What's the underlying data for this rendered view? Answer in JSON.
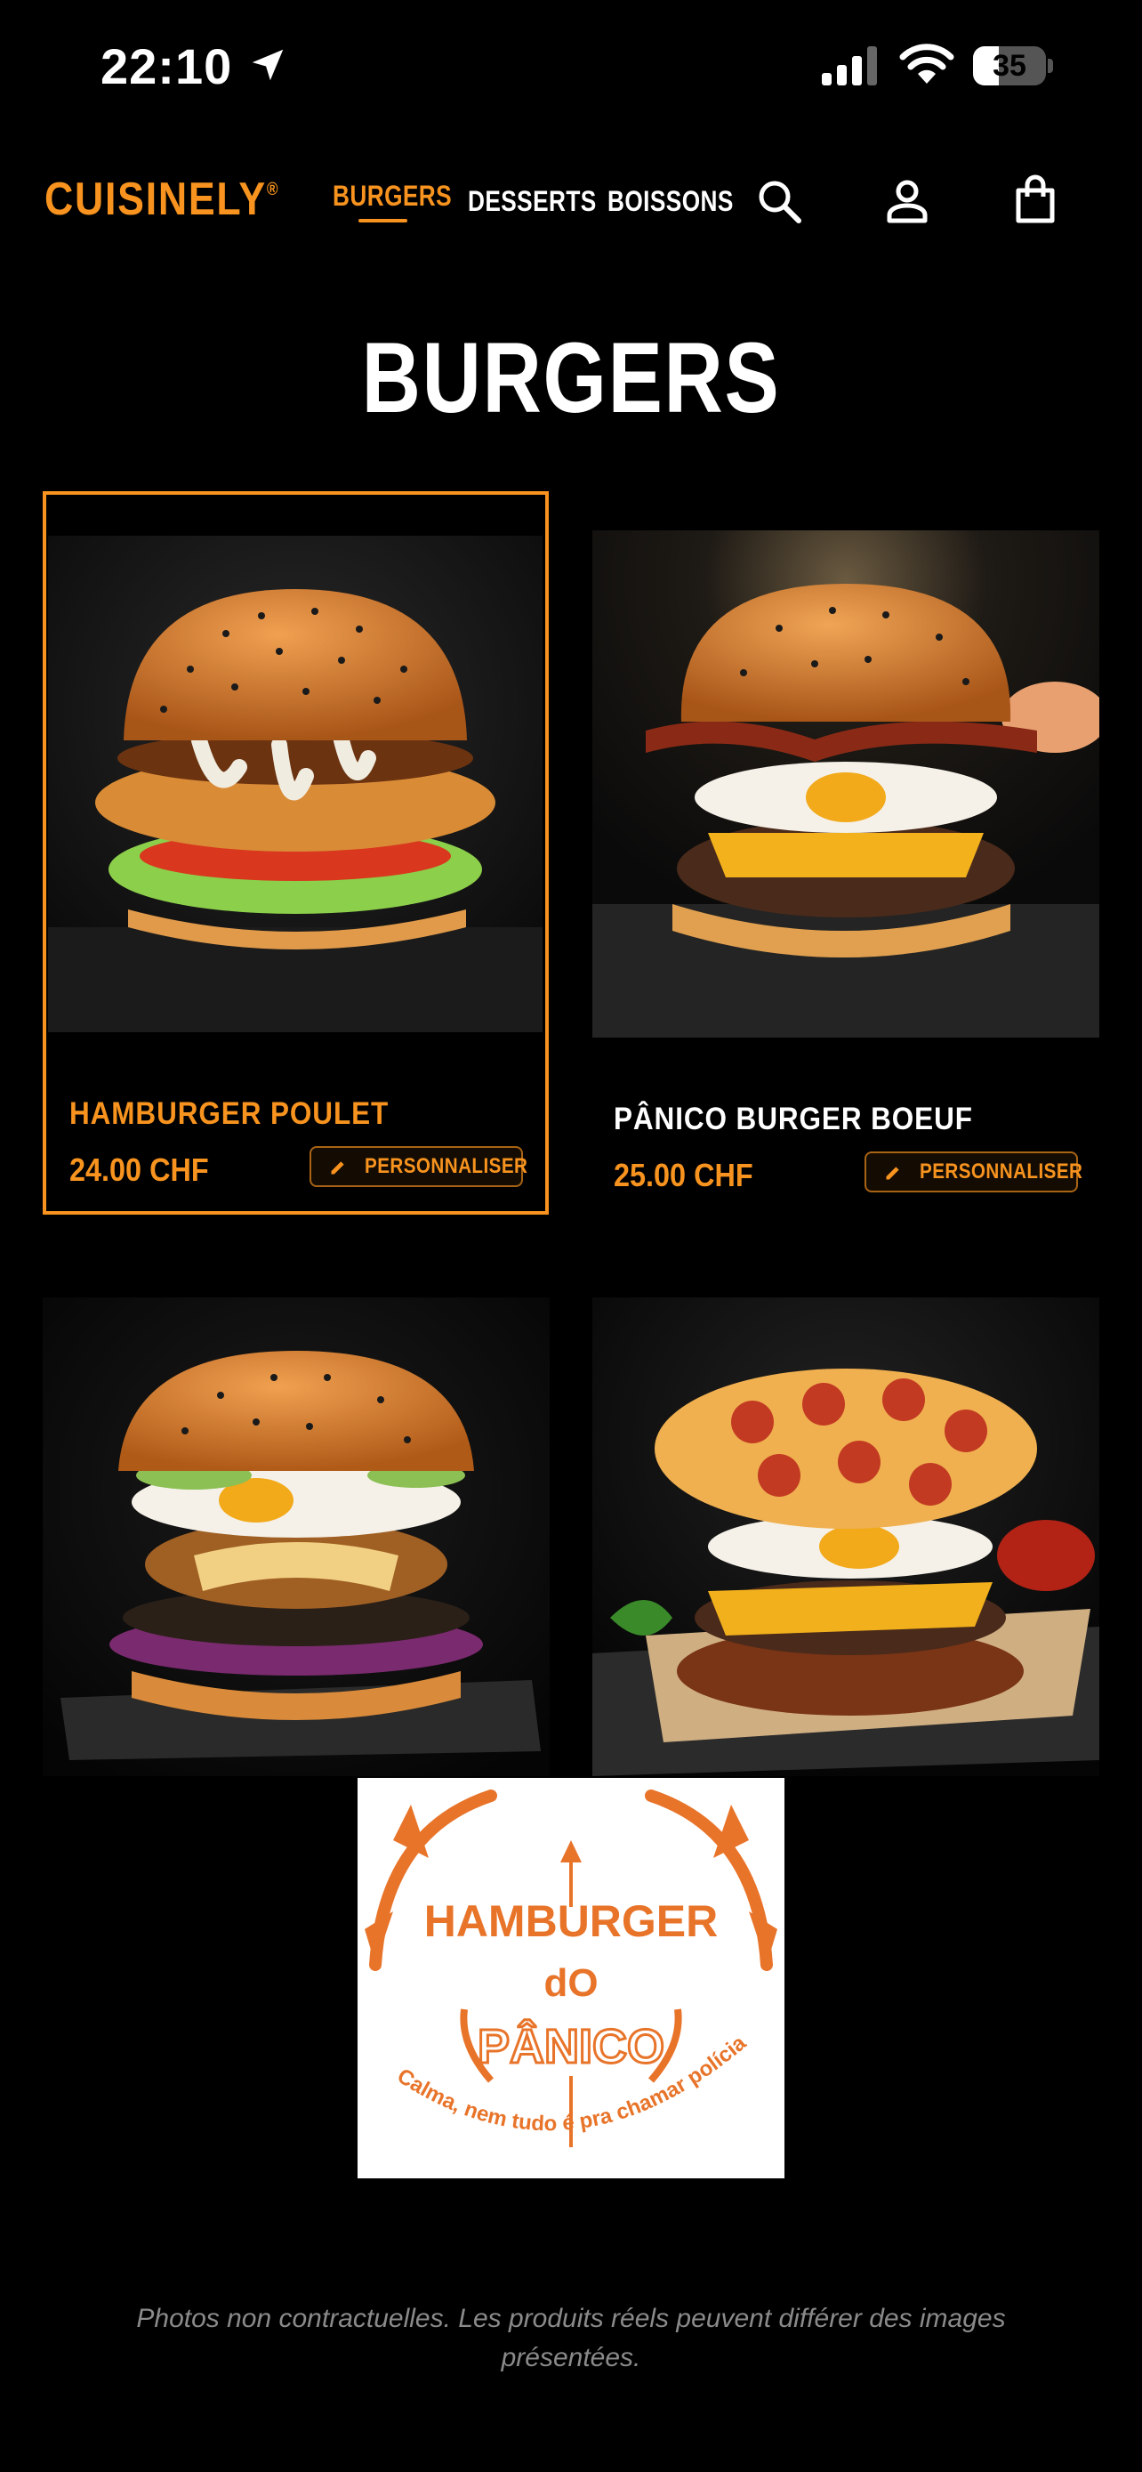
{
  "status_bar": {
    "time": "22:10",
    "battery": "35",
    "battery_level": 0.35
  },
  "nav": {
    "brand": "CUISINELY",
    "brand_mark": "®",
    "links": [
      {
        "label": "BURGERS",
        "active": true
      },
      {
        "label": "DESSERTS",
        "active": false
      },
      {
        "label": "BOISSONS",
        "active": false
      }
    ],
    "icons": [
      "search-icon",
      "user-icon",
      "shopping-bag-icon"
    ]
  },
  "page": {
    "title": "BURGERS"
  },
  "products": [
    {
      "name": "HAMBURGER POULET",
      "price": "24.00 CHF",
      "button": "PERSONNALISER",
      "selected": true
    },
    {
      "name": "PÂNICO BURGER BOEUF",
      "price": "25.00 CHF",
      "button": "PERSONNALISER",
      "selected": false
    },
    {
      "name": "",
      "price": "",
      "button": ""
    },
    {
      "name": "",
      "price": "",
      "button": ""
    }
  ],
  "promo": {
    "line1": "HAMBURGER",
    "line2": "dO",
    "line3": "PÂNICO",
    "tagline": "Calma, nem tudo é pra chamar polícia"
  },
  "footer": {
    "disclaimer": "Photos non contractuelles. Les produits réels peuvent différer des images présentées."
  },
  "colors": {
    "accent": "#f7931e",
    "background": "#000000",
    "promo_orange": "#e8742a"
  }
}
